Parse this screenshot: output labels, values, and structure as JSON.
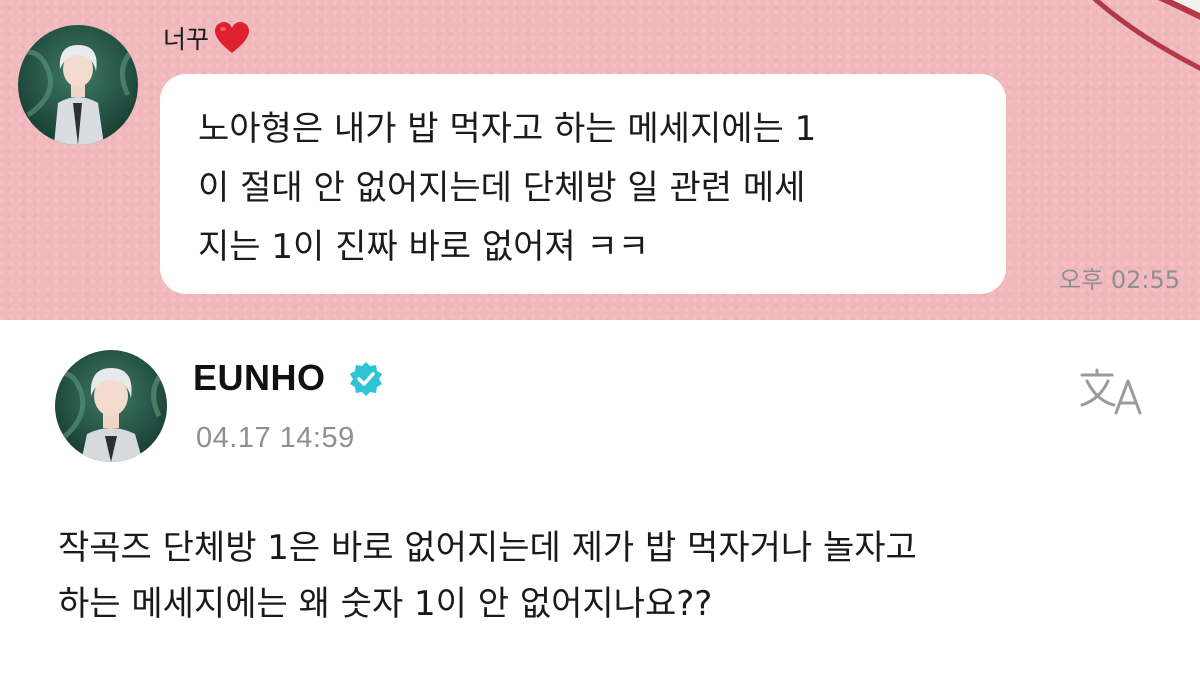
{
  "colors": {
    "chat_background": "#f2b9bd",
    "bubble": "#ffffff",
    "heart": "#e0202e",
    "verified": "#2fc3d6",
    "muted_text": "#8e8e93"
  },
  "chat": {
    "sender_name": "너꾸",
    "sender_badge_icon": "heart-icon",
    "message": "노아형은 내가 밥 먹자고 하는 메세지에는 1\n이 절대 안 없어지는데 단체방 일 관련 메세\n지는 1이 진짜 바로 없어져 ㅋㅋ",
    "time": "오후 02:55"
  },
  "post": {
    "author": "EUNHO",
    "verified_icon": "verified-badge-icon",
    "date": "04.17 14:59",
    "translate_icon": "translate-icon",
    "body": "작곡즈 단체방 1은 바로 없어지는데 제가 밥 먹자거나 놀자고\n하는 메세지에는 왜 숫자 1이 안 없어지나요??"
  }
}
